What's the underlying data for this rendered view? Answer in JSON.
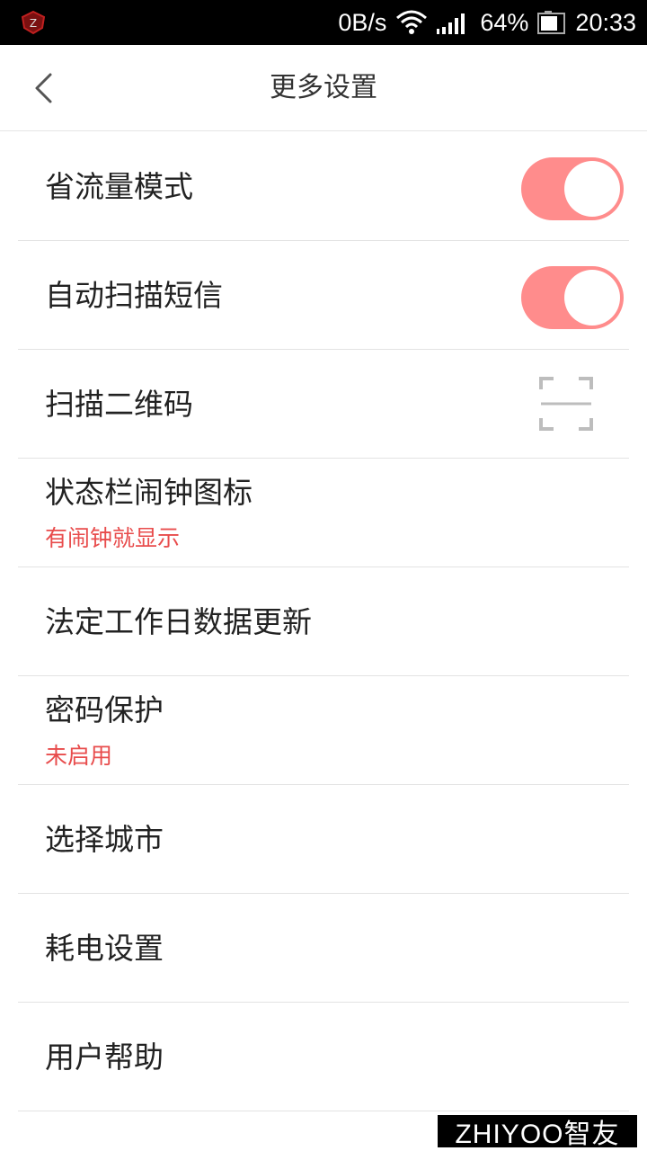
{
  "status_bar": {
    "speed": "0B/s",
    "battery_percent": "64%",
    "time": "20:33"
  },
  "header": {
    "title": "更多设置"
  },
  "settings": [
    {
      "label": "省流量模式",
      "control": "toggle",
      "on": true
    },
    {
      "label": "自动扫描短信",
      "control": "toggle",
      "on": true
    },
    {
      "label": "扫描二维码",
      "control": "scan-icon"
    },
    {
      "label": "状态栏闹钟图标",
      "sub": "有闹钟就显示"
    },
    {
      "label": "法定工作日数据更新"
    },
    {
      "label": "密码保护",
      "sub": "未启用"
    },
    {
      "label": "选择城市"
    },
    {
      "label": "耗电设置"
    },
    {
      "label": "用户帮助"
    }
  ],
  "colors": {
    "toggle_on": "#ff8c8c",
    "subtitle": "#e84c4c",
    "divider": "#e3e3e3"
  },
  "watermark": "ZHIYOO智友"
}
